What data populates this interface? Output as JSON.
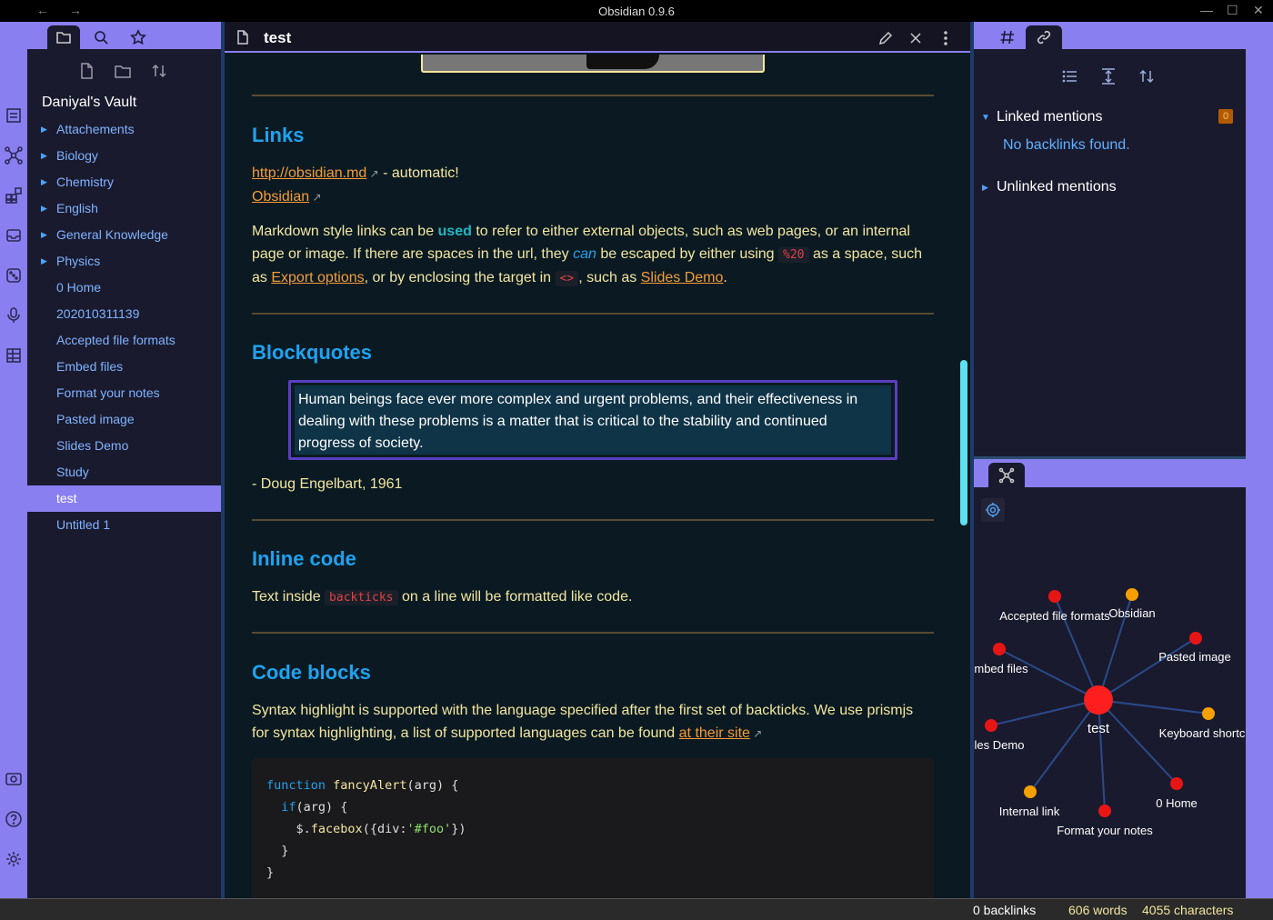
{
  "window": {
    "title": "Obsidian 0.9.6",
    "back": "←",
    "forward": "→",
    "minimize": "—",
    "maximize": "☐",
    "close": "✕"
  },
  "sidebar": {
    "vault_name": "Daniyal's Vault",
    "items": [
      {
        "label": "Attachements",
        "folder": true
      },
      {
        "label": "Biology",
        "folder": true
      },
      {
        "label": "Chemistry",
        "folder": true
      },
      {
        "label": "English",
        "folder": true
      },
      {
        "label": "General Knowledge",
        "folder": true
      },
      {
        "label": "Physics",
        "folder": true
      },
      {
        "label": "0 Home",
        "folder": false
      },
      {
        "label": "202010311139",
        "folder": false
      },
      {
        "label": "Accepted file formats",
        "folder": false
      },
      {
        "label": "Embed files",
        "folder": false
      },
      {
        "label": "Format your notes",
        "folder": false
      },
      {
        "label": "Pasted image",
        "folder": false
      },
      {
        "label": "Slides Demo",
        "folder": false
      },
      {
        "label": "Study",
        "folder": false
      },
      {
        "label": "test",
        "folder": false,
        "active": true
      },
      {
        "label": "Untitled 1",
        "folder": false
      }
    ]
  },
  "editor": {
    "tab_title": "test",
    "links_heading": "Links",
    "link1": "http://obsidian.md",
    "link1_suffix": " - automatic!",
    "link2": "Obsidian",
    "md_p_a": "Markdown style links can be ",
    "md_strong": "used",
    "md_p_b": " to refer to either external objects, such as web pages, or an internal page or image. If there are spaces in the url, they ",
    "md_em": "can",
    "md_p_c": " be escaped by either using ",
    "md_code1": "%20",
    "md_p_d": " as a space, such as ",
    "md_link_export": "Export options",
    "md_p_e": ", or by enclosing the target in ",
    "md_code2": "<>",
    "md_p_f": ", such as ",
    "md_link_slides": "Slides Demo",
    "md_p_g": ".",
    "blockquotes_heading": "Blockquotes",
    "quote": "Human beings face ever more complex and urgent problems, and their effectiveness in dealing with these problems is a matter that is critical to the stability and continued progress of society.",
    "attribution": "- Doug Engelbart, 1961",
    "inline_heading": "Inline code",
    "inline_a": "Text inside ",
    "inline_code": "backticks",
    "inline_b": " on a line will be formatted like code.",
    "codeblocks_heading": "Code blocks",
    "cb_p_a": "Syntax highlight is supported with the language specified after the first set of backticks. We use prismjs for syntax highlighting, a list of supported languages can be found ",
    "cb_link": "at their site",
    "code": {
      "l1_kw": "function",
      "l1_fn": "fancyAlert",
      "l1_rest": "(arg) {",
      "l2_kw": "if",
      "l2_rest": "(arg) {",
      "l3_a": "$.",
      "l3_fn": "facebox",
      "l3_b": "({div:",
      "l3_str": "'#foo'",
      "l3_c": "})",
      "l4": "}",
      "l5": "}"
    }
  },
  "backlinks": {
    "linked_label": "Linked mentions",
    "linked_count": "0",
    "no_backlinks": "No backlinks found.",
    "unlinked_label": "Unlinked mentions"
  },
  "graph": {
    "center": {
      "label": "test"
    },
    "nodes": [
      {
        "label": "Accepted file formats",
        "color": "#e81515"
      },
      {
        "label": "Obsidian",
        "color": "#f5a000"
      },
      {
        "label": "Pasted image",
        "color": "#e81515"
      },
      {
        "label": "mbed files",
        "color": "#e81515"
      },
      {
        "label": "Keyboard shortc",
        "color": "#f5a000"
      },
      {
        "label": "les Demo",
        "color": "#e81515"
      },
      {
        "label": "0 Home",
        "color": "#e81515"
      },
      {
        "label": "Internal link",
        "color": "#f5a000"
      },
      {
        "label": "Format your notes",
        "color": "#e81515"
      }
    ]
  },
  "status": {
    "backlinks": "0 backlinks",
    "words": "606 words",
    "characters": "4055 characters"
  }
}
